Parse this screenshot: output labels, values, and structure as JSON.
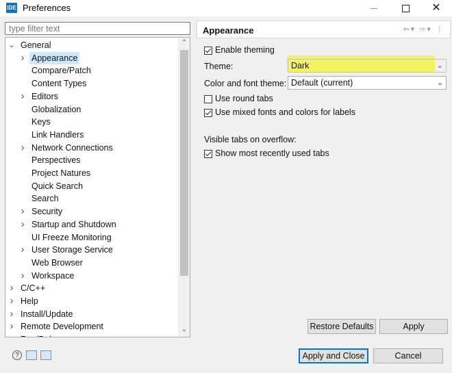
{
  "window": {
    "icon_text": "IDE",
    "title": "Preferences",
    "min_icon": "minimize-icon",
    "max_icon": "maximize-icon",
    "close_icon": "close-icon",
    "close_glyph": "✕"
  },
  "filter": {
    "placeholder": "type filter text"
  },
  "tree": {
    "items": [
      {
        "label": "General",
        "level": 0,
        "expanded": true
      },
      {
        "label": "Appearance",
        "level": 1,
        "expandable": true,
        "selected": true
      },
      {
        "label": "Compare/Patch",
        "level": 1
      },
      {
        "label": "Content Types",
        "level": 1
      },
      {
        "label": "Editors",
        "level": 1,
        "expandable": true
      },
      {
        "label": "Globalization",
        "level": 1
      },
      {
        "label": "Keys",
        "level": 1
      },
      {
        "label": "Link Handlers",
        "level": 1
      },
      {
        "label": "Network Connections",
        "level": 1,
        "expandable": true
      },
      {
        "label": "Perspectives",
        "level": 1
      },
      {
        "label": "Project Natures",
        "level": 1
      },
      {
        "label": "Quick Search",
        "level": 1
      },
      {
        "label": "Search",
        "level": 1
      },
      {
        "label": "Security",
        "level": 1,
        "expandable": true
      },
      {
        "label": "Startup and Shutdown",
        "level": 1,
        "expandable": true
      },
      {
        "label": "UI Freeze Monitoring",
        "level": 1
      },
      {
        "label": "User Storage Service",
        "level": 1,
        "expandable": true
      },
      {
        "label": "Web Browser",
        "level": 1
      },
      {
        "label": "Workspace",
        "level": 1,
        "expandable": true
      },
      {
        "label": "C/C++",
        "level": 0,
        "expandable": true
      },
      {
        "label": "Help",
        "level": 0,
        "expandable": true
      },
      {
        "label": "Install/Update",
        "level": 0,
        "expandable": true
      },
      {
        "label": "Remote Development",
        "level": 0,
        "expandable": true
      },
      {
        "label": "Run/Debug",
        "level": 0,
        "expandable": true
      }
    ]
  },
  "panel": {
    "title": "Appearance",
    "enable_theming": {
      "label": "Enable theming",
      "checked": true
    },
    "theme_label": "Theme:",
    "theme_value": "Dark",
    "font_theme_label": "Color and font theme:",
    "font_theme_value": "Default (current)",
    "round_tabs": {
      "label": "Use round tabs",
      "checked": false
    },
    "mixed_fonts": {
      "label": "Use mixed fonts and colors for labels",
      "checked": true
    },
    "overflow_label": "Visible tabs on overflow:",
    "recent_tabs": {
      "label": "Show most recently used tabs",
      "checked": true
    },
    "restore_defaults": "Restore Defaults",
    "apply": "Apply"
  },
  "footer": {
    "apply_close": "Apply and Close",
    "cancel": "Cancel",
    "help_glyph": "?"
  },
  "colors": {
    "highlight": "#f1f34a",
    "selection": "#cce8ff",
    "accent": "#0078d7"
  }
}
